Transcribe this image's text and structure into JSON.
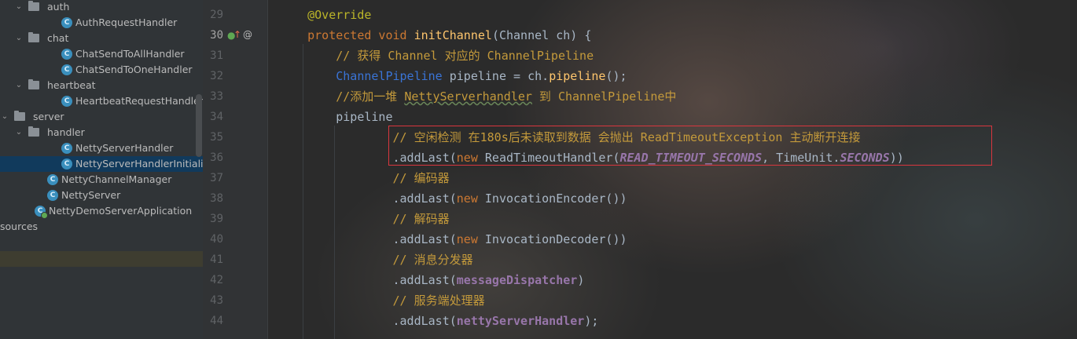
{
  "tree": {
    "items": [
      {
        "label": "auth",
        "type": "folder",
        "expanded": true
      },
      {
        "label": "AuthRequestHandler",
        "type": "class"
      },
      {
        "label": "chat",
        "type": "folder",
        "expanded": true
      },
      {
        "label": "ChatSendToAllHandler",
        "type": "class"
      },
      {
        "label": "ChatSendToOneHandler",
        "type": "class"
      },
      {
        "label": "heartbeat",
        "type": "folder",
        "expanded": true
      },
      {
        "label": "HeartbeatRequestHandler",
        "type": "class"
      },
      {
        "label": "server",
        "type": "folder",
        "expanded": true
      },
      {
        "label": "handler",
        "type": "folder",
        "expanded": true
      },
      {
        "label": "NettyServerHandler",
        "type": "class"
      },
      {
        "label": "NettyServerHandlerInitializer",
        "type": "class",
        "selected": true
      },
      {
        "label": "NettyChannelManager",
        "type": "class"
      },
      {
        "label": "NettyServer",
        "type": "class"
      },
      {
        "label": "NettyDemoServerApplication",
        "type": "app"
      },
      {
        "label": "sources",
        "type": "folder-partial"
      }
    ],
    "class_badge": "C"
  },
  "gutter": {
    "line_numbers": [
      "29",
      "30",
      "31",
      "32",
      "33",
      "34",
      "35",
      "36",
      "37",
      "38",
      "39",
      "40",
      "41",
      "42",
      "43",
      "44"
    ],
    "override_marker": "@",
    "implements_marker": "↑"
  },
  "code": {
    "lines": [
      [
        {
          "t": "    @Override",
          "c": "ann"
        }
      ],
      [
        {
          "t": "    protected void ",
          "c": "kw"
        },
        {
          "t": "initChannel",
          "c": "fn"
        },
        {
          "t": "(Channel ch) {",
          "c": "pl"
        }
      ],
      [
        {
          "t": "        // 获得 Channel 对应的 ChannelPipeline",
          "c": "cmc"
        }
      ],
      [
        {
          "t": "        ",
          "c": "pl"
        },
        {
          "t": "ChannelPipeline",
          "c": "cls"
        },
        {
          "t": " pipeline = ch.",
          "c": "pl"
        },
        {
          "t": "pipeline",
          "c": "fn"
        },
        {
          "t": "();",
          "c": "pl"
        }
      ],
      [
        {
          "t": "        //添加一堆 ",
          "c": "cmc"
        },
        {
          "t": "NettyServerhandler",
          "c": "cmc ul"
        },
        {
          "t": " 到 ChannelPipeline中",
          "c": "cmc"
        }
      ],
      [
        {
          "t": "        pipeline",
          "c": "pl"
        }
      ],
      [
        {
          "t": "                // 空闲检测 在180s后未读取到数据 会抛出 ReadTimeoutException 主动断开连接",
          "c": "cmc"
        }
      ],
      [
        {
          "t": "                .addLast(",
          "c": "pl"
        },
        {
          "t": "new ",
          "c": "kw"
        },
        {
          "t": "ReadTimeoutHandler(",
          "c": "pl"
        },
        {
          "t": "READ_TIMEOUT_SECONDS",
          "c": "fldi"
        },
        {
          "t": ", TimeUnit.",
          "c": "pl"
        },
        {
          "t": "SECONDS",
          "c": "fldi"
        },
        {
          "t": "))",
          "c": "pl"
        }
      ],
      [
        {
          "t": "                // 编码器",
          "c": "cmc"
        }
      ],
      [
        {
          "t": "                .addLast(",
          "c": "pl"
        },
        {
          "t": "new ",
          "c": "kw"
        },
        {
          "t": "InvocationEncoder())",
          "c": "pl"
        }
      ],
      [
        {
          "t": "                // 解码器",
          "c": "cmc"
        }
      ],
      [
        {
          "t": "                .addLast(",
          "c": "pl"
        },
        {
          "t": "new ",
          "c": "kw"
        },
        {
          "t": "InvocationDecoder())",
          "c": "pl"
        }
      ],
      [
        {
          "t": "                // 消息分发器",
          "c": "cmc"
        }
      ],
      [
        {
          "t": "                .addLast(",
          "c": "pl"
        },
        {
          "t": "messageDispatcher",
          "c": "fld"
        },
        {
          "t": ")",
          "c": "pl"
        }
      ],
      [
        {
          "t": "                // 服务端处理器",
          "c": "cmc"
        }
      ],
      [
        {
          "t": "                .addLast(",
          "c": "pl"
        },
        {
          "t": "nettyServerHandler",
          "c": "fld"
        },
        {
          "t": ");",
          "c": "pl"
        }
      ]
    ]
  },
  "colors": {
    "highlight_box": "#d9363e",
    "selection": "#113a5c"
  }
}
